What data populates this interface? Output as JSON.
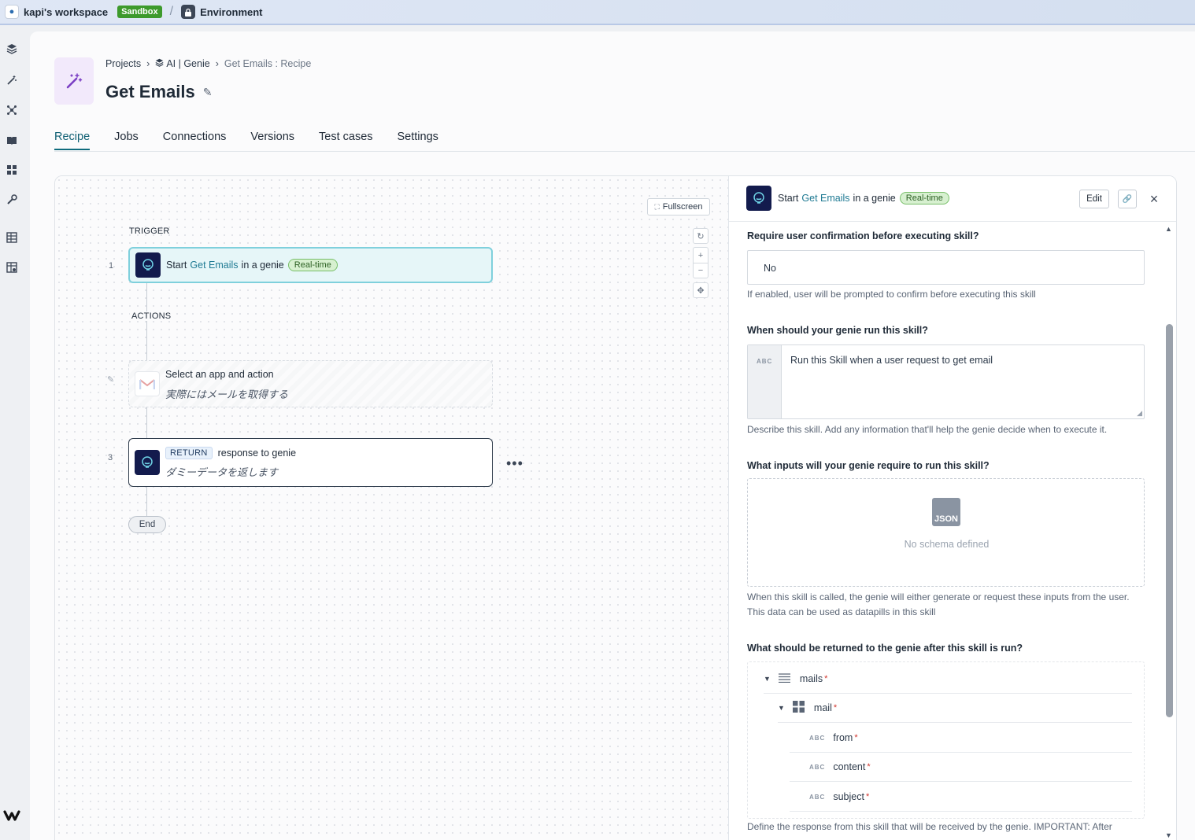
{
  "topbar": {
    "workspace": "kapi's workspace",
    "sandbox_badge": "Sandbox",
    "environment": "Environment"
  },
  "sidebar": {
    "icons": [
      "layers-icon",
      "magic-wand-icon",
      "network-icon",
      "book-icon",
      "dashboard-icon",
      "wrench-icon",
      "table-icon",
      "settings-table-icon"
    ],
    "logo": "w"
  },
  "header": {
    "breadcrumb": {
      "projects": "Projects",
      "folder": "AI | Genie",
      "current": "Get Emails : Recipe"
    },
    "title": "Get Emails"
  },
  "tabs": [
    {
      "label": "Recipe",
      "active": true
    },
    {
      "label": "Jobs"
    },
    {
      "label": "Connections"
    },
    {
      "label": "Versions"
    },
    {
      "label": "Test cases"
    },
    {
      "label": "Settings"
    }
  ],
  "canvas": {
    "fullscreen_label": "Fullscreen",
    "trigger_label": "TRIGGER",
    "actions_label": "ACTIONS",
    "steps": {
      "trigger": {
        "num": "1",
        "start": "Start",
        "name": "Get Emails",
        "suffix": "in a genie",
        "pill": "Real-time"
      },
      "action": {
        "title": "Select an app and action",
        "note": "実際にはメールを取得する"
      },
      "ret": {
        "num": "3",
        "tag": "RETURN",
        "title": "response to genie",
        "note": "ダミーデータを返します"
      }
    },
    "end_label": "End"
  },
  "panel": {
    "header": {
      "start": "Start",
      "name": "Get Emails",
      "suffix": "in a genie",
      "pill": "Real-time",
      "edit_label": "Edit"
    },
    "confirm": {
      "label": "Require user confirmation before executing skill?",
      "value": "No",
      "hint": "If enabled, user will be prompted to confirm before executing this skill"
    },
    "when": {
      "label": "When should your genie run this skill?",
      "type_tag": "ABC",
      "value": "Run this Skill when a user request to get email",
      "hint": "Describe this skill. Add any information that'll help the genie decide when to execute it."
    },
    "inputs": {
      "label": "What inputs will your genie require to run this skill?",
      "json_label": "JSON",
      "empty": "No schema defined",
      "hint": "When this skill is called, the genie will either generate or request these inputs from the user. This data can be used as datapills in this skill"
    },
    "returns": {
      "label": "What should be returned to the genie after this skill is run?",
      "tree": [
        {
          "name": "mails",
          "kind": "list-icon",
          "level": 0
        },
        {
          "name": "mail",
          "kind": "object-icon",
          "level": 1
        },
        {
          "name": "from",
          "kind": "ABC",
          "level": 2
        },
        {
          "name": "content",
          "kind": "ABC",
          "level": 2
        },
        {
          "name": "subject",
          "kind": "ABC",
          "level": 2
        }
      ],
      "hint": "Define the response from this skill that will be received by the genie. IMPORTANT: After"
    }
  },
  "colors": {
    "accent": "#0f6b7d",
    "highlight_text": "#1f7a93",
    "sandbox": "#3d9a2c",
    "genie_tile": "#131b4d",
    "realtime_pill": "#d7f0d0"
  }
}
